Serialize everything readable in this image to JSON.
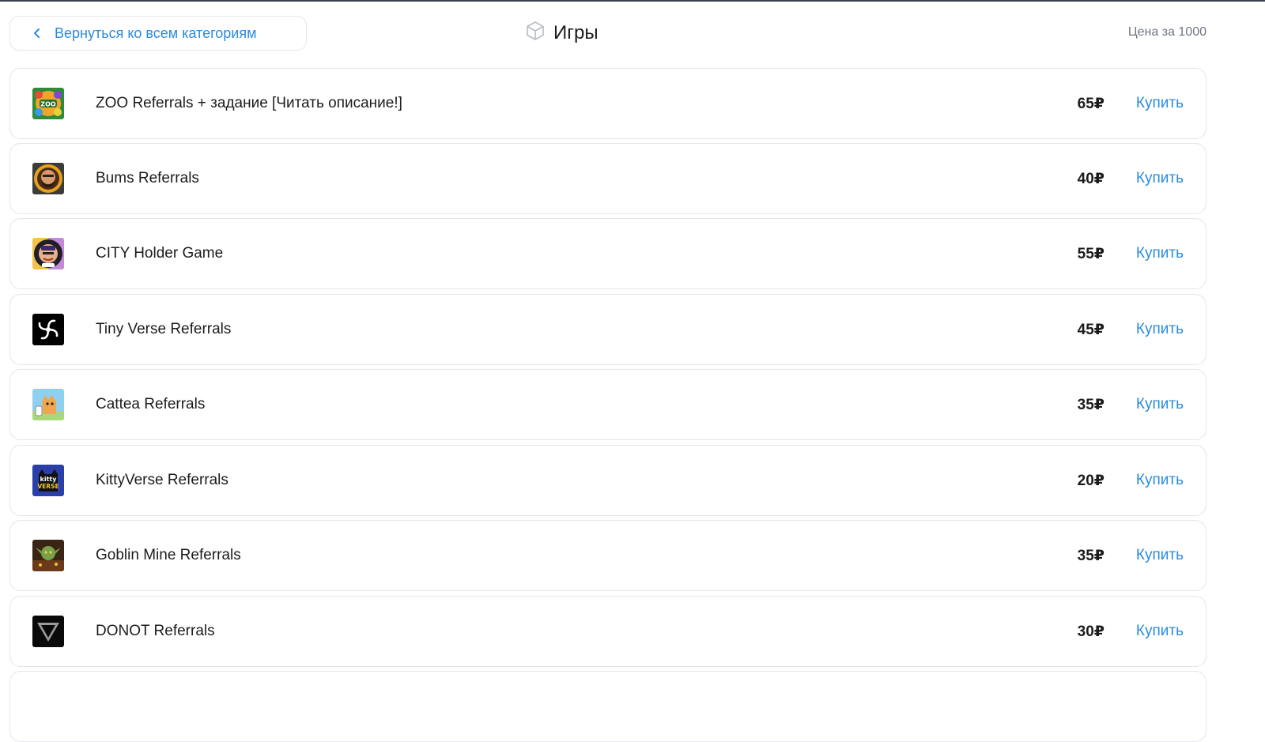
{
  "header": {
    "back_label": "Вернуться ко всем категориям",
    "title": "Игры",
    "price_label": "Цена за 1000"
  },
  "items": [
    {
      "name": "ZOO Referrals + задание [Читать описание!]",
      "price": "65₽",
      "buy": "Купить",
      "icon": "zoo-logo"
    },
    {
      "name": "Bums Referrals",
      "price": "40₽",
      "buy": "Купить",
      "icon": "bums-logo"
    },
    {
      "name": "CITY Holder Game",
      "price": "55₽",
      "buy": "Купить",
      "icon": "city-holder-logo"
    },
    {
      "name": "Tiny Verse Referrals",
      "price": "45₽",
      "buy": "Купить",
      "icon": "tiny-verse-logo"
    },
    {
      "name": "Cattea Referrals",
      "price": "35₽",
      "buy": "Купить",
      "icon": "cattea-logo"
    },
    {
      "name": "KittyVerse Referrals",
      "price": "20₽",
      "buy": "Купить",
      "icon": "kittyverse-logo"
    },
    {
      "name": "Goblin Mine Referrals",
      "price": "35₽",
      "buy": "Купить",
      "icon": "goblin-mine-logo"
    },
    {
      "name": "DONOT Referrals",
      "price": "30₽",
      "buy": "Купить",
      "icon": "donot-logo"
    }
  ],
  "colors": {
    "accent": "#2a8bdf",
    "border": "#e3e6ea",
    "muted": "#6f7680"
  }
}
